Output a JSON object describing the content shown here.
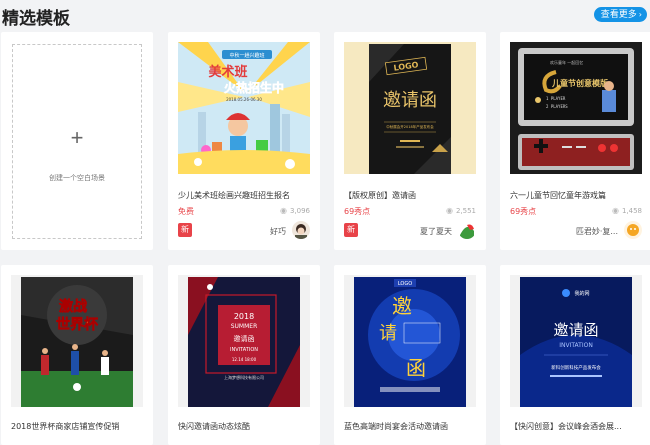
{
  "header": {
    "title": "精选模板",
    "more_label": "查看更多",
    "more_icon": "chevron-right"
  },
  "blank_card": {
    "plus": "+",
    "label": "创建一个空白场景"
  },
  "row1": [
    {
      "title": "少儿美术班绘画兴趣班招生报名",
      "price": "免费",
      "views": "3,096",
      "new": true,
      "author": "好巧",
      "poster": {
        "banner": "中秋一趟兴趣班",
        "headline_a": "美术班",
        "headline_b": "火热招生中",
        "date": "2018.05.26-06.30"
      }
    },
    {
      "title": "【版权原创】邀请函",
      "price": "69秀点",
      "views": "2,551",
      "new": true,
      "author": "夏了夏天",
      "poster": {
        "logo": "LOGO",
        "headline": "邀请函",
        "sub": "中秋展会开2018年产品发布会"
      }
    },
    {
      "title": "六一儿童节回忆童年游戏篇",
      "price": "69秀点",
      "views": "1,458",
      "new": false,
      "author": "匹君妙·复...",
      "poster": {
        "headline": "儿童节创意模版",
        "option1": "1 PLAYER",
        "option2": "2 PLAYERS"
      }
    }
  ],
  "row2": [
    {
      "title": "2018世界杯商家店铺宣传促销",
      "poster": {
        "headline_a": "激战",
        "headline_b": "世界杯"
      }
    },
    {
      "title": "快闪邀请函动态炫酷",
      "poster": {
        "year": "2018",
        "season": "SUMMER",
        "word": "邀请函",
        "en": "INVITATION",
        "date": "12.14 18:00",
        "place": "上海梦想科技有限公司"
      }
    },
    {
      "title": "蓝色高端时尚宴会活动邀请函",
      "poster": {
        "logo": "LOGO",
        "char1": "邀",
        "char2": "请",
        "char3": "函"
      }
    },
    {
      "title": "【快闪创意】会议峰会酒会展...",
      "poster": {
        "brand": "我的网",
        "headline": "邀请函",
        "en": "INVITATION",
        "sub": "新科创新科技产品发布会"
      }
    }
  ],
  "colors": {
    "accent": "#1493e6",
    "price": "#e8464a",
    "new_badge": "#e84349"
  }
}
